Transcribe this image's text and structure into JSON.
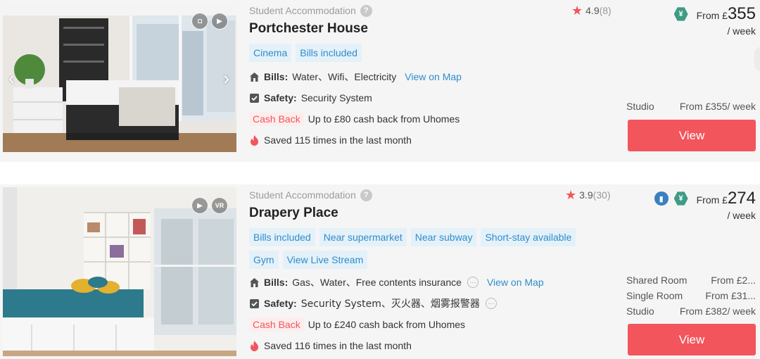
{
  "listings": [
    {
      "category": "Student Accommodation",
      "help_glyph": "?",
      "name": "Portchester House",
      "rating": "4.9",
      "rating_count": "(8)",
      "photo_badges": [
        "◘",
        "▶"
      ],
      "tags": [
        "Cinema",
        "Bills included"
      ],
      "bills_label": "Bills:",
      "bills_value": "Water、Wifi、Electricity",
      "view_on_map": "View on Map",
      "safety_label": "Safety:",
      "safety_value": "Security System",
      "cash_back_label": "Cash Back",
      "cash_back_text": "Up to £80 cash back from Uhomes",
      "saved_text": "Saved 115 times in the last month",
      "price_from": "From £",
      "price_amount": "355",
      "price_unit": "/ week",
      "rooms": [
        {
          "type": "Studio",
          "price": "From £355/ week"
        }
      ],
      "view_label": "View"
    },
    {
      "category": "Student Accommodation",
      "help_glyph": "?",
      "name": "Drapery Place",
      "rating": "3.9",
      "rating_count": "(30)",
      "photo_badges": [
        "▶",
        "VR"
      ],
      "tags": [
        "Bills included",
        "Near supermarket",
        "Near subway",
        "Short-stay available",
        "Gym",
        "View Live Stream"
      ],
      "bills_label": "Bills:",
      "bills_value": "Gas、Water、Free contents insurance",
      "view_on_map": "View on Map",
      "safety_label": "Safety:",
      "safety_value": "Security System、灭火器、烟雾报警器",
      "cash_back_label": "Cash Back",
      "cash_back_text": "Up to £240 cash back from Uhomes",
      "saved_text": "Saved 116 times in the last month",
      "price_from": "From £",
      "price_amount": "274",
      "price_unit": "/ week",
      "rooms": [
        {
          "type": "Shared Room",
          "price": "From £2..."
        },
        {
          "type": "Single Room",
          "price": "From £31..."
        },
        {
          "type": "Studio",
          "price": "From £382/ week"
        }
      ],
      "view_label": "View"
    }
  ],
  "icons": {
    "star": "★",
    "currency_badge": "¥",
    "id_badge": "▮",
    "more": "···",
    "arrow_left": "‹",
    "arrow_right": "›"
  },
  "colors": {
    "accent_red": "#f2555b",
    "link_blue": "#2f8ccc",
    "tag_bg": "#e4f1f9",
    "card_bg": "#f5f5f5",
    "badge_green": "#3f9b85"
  }
}
